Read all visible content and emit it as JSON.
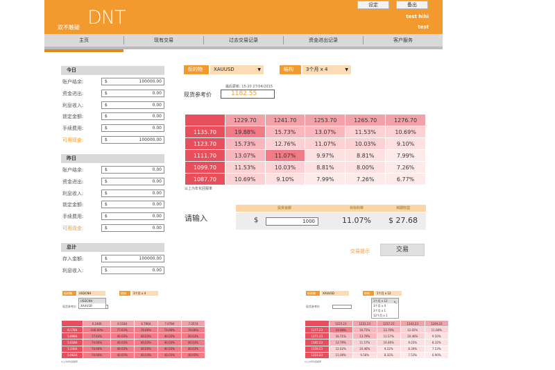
{
  "header": {
    "logo": "DNT",
    "tagline": "双不触碰",
    "btn_settings": "设定",
    "btn_logout": "备出",
    "user_line1": "test hihi",
    "user_line2": "test"
  },
  "nav": [
    "主页",
    "现有交易",
    "过去交易记录",
    "资金进出记录",
    "客户服务"
  ],
  "today": {
    "title": "今日",
    "rows": [
      {
        "label": "账户结余:",
        "currency": "$",
        "value": "100000.00",
        "highlight": false
      },
      {
        "label": "资金进出:",
        "currency": "$",
        "value": "0.00",
        "highlight": false
      },
      {
        "label": "利息收入:",
        "currency": "$",
        "value": "0.00",
        "highlight": false
      },
      {
        "label": "锁定金额:",
        "currency": "$",
        "value": "0.00",
        "highlight": false
      },
      {
        "label": "手续费用:",
        "currency": "$",
        "value": "0.00",
        "highlight": false
      },
      {
        "label": "可用现金:",
        "currency": "$",
        "value": "100000.00",
        "highlight": true
      }
    ]
  },
  "yesterday": {
    "title": "昨日",
    "rows": [
      {
        "label": "账户结余:",
        "currency": "$",
        "value": "0.00",
        "highlight": false
      },
      {
        "label": "资金进出:",
        "currency": "$",
        "value": "0.00",
        "highlight": false
      },
      {
        "label": "利息收入:",
        "currency": "$",
        "value": "0.00",
        "highlight": false
      },
      {
        "label": "锁定金额:",
        "currency": "$",
        "value": "0.00",
        "highlight": false
      },
      {
        "label": "手续费用:",
        "currency": "$",
        "value": "0.00",
        "highlight": false
      },
      {
        "label": "可用现金:",
        "currency": "$",
        "value": "0.00",
        "highlight": true
      }
    ]
  },
  "total": {
    "title": "总计",
    "rows": [
      {
        "label": "存入金额:",
        "currency": "$",
        "value": "100000.00",
        "highlight": false
      },
      {
        "label": "利息收入:",
        "currency": "$",
        "value": "0.00",
        "highlight": false
      }
    ]
  },
  "controls": {
    "underlying_label": "标的物",
    "underlying_value": "XAUUSD",
    "structure_label": "结构",
    "structure_value": "3个月 x 4",
    "updated": "最后更新: 15:20 27/04/2015",
    "ref_price_label": "现货参考价",
    "ref_price": "1182.55"
  },
  "matrix": {
    "cols": [
      "1229.70",
      "1241.70",
      "1253.70",
      "1265.70",
      "1276.70"
    ],
    "rows": [
      {
        "h": "1135.70",
        "v": [
          "19.88%",
          "15.73%",
          "13.07%",
          "11.53%",
          "10.69%"
        ]
      },
      {
        "h": "1123.70",
        "v": [
          "15.73%",
          "12.76%",
          "11.07%",
          "10.03%",
          "9.10%"
        ]
      },
      {
        "h": "1111.70",
        "v": [
          "13.07%",
          "11.07%",
          "9.97%",
          "8.81%",
          "7.99%"
        ]
      },
      {
        "h": "1099.70",
        "v": [
          "11.53%",
          "10.03%",
          "8.81%",
          "8.00%",
          "7.26%"
        ]
      },
      {
        "h": "1087.70",
        "v": [
          "10.69%",
          "9.10%",
          "7.99%",
          "7.26%",
          "6.77%"
        ]
      }
    ],
    "note": "以上为年化回报率"
  },
  "input_section": {
    "prompt": "请输入",
    "h_amount": "投资金额",
    "h_rate": "目标利率",
    "h_return": "到期收益",
    "currency": "$",
    "amount": "1000",
    "rate": "11.07%",
    "return": "$ 27.68",
    "hint": "交易提示",
    "trade_btn": "交易"
  },
  "thumb_left": {
    "underlying_label": "标的物",
    "underlying_value": "USDCNH",
    "structure_label": "结构",
    "structure_value": "3个月 x 4",
    "ref_label": "现货参考价",
    "dropdown": [
      "USDCNH",
      "XAUUSD"
    ],
    "cols": [
      "6.2406",
      "6.5184",
      "6.7964",
      "7.0784",
      "7.3574"
    ],
    "rows": [
      {
        "h": "6.1784",
        "v": [
          "100.00%",
          "77.63%",
          "74.66%",
          "74.66%",
          "74.66%"
        ]
      },
      {
        "h": "5.8964",
        "v": [
          "77.63%",
          "40.03%",
          "40.03%",
          "40.03%",
          "40.03%"
        ]
      },
      {
        "h": "5.6184",
        "v": [
          "74.66%",
          "40.03%",
          "40.03%",
          "40.03%",
          "40.03%"
        ]
      },
      {
        "h": "5.3404",
        "v": [
          "74.66%",
          "40.03%",
          "40.03%",
          "40.03%",
          "40.03%"
        ]
      },
      {
        "h": "5.0624",
        "v": [
          "74.66%",
          "40.03%",
          "40.03%",
          "40.03%",
          "40.03%"
        ]
      }
    ],
    "note": "以上为年化回报率"
  },
  "thumb_right": {
    "underlying_label": "标的物",
    "underlying_value": "XAUUSD",
    "structure_label": "结构",
    "structure_value": "1个月 x 12",
    "ref_label": "现货参考价",
    "dropdown": [
      "1个月 x 12",
      "3个月 x 4",
      "3个月 x 1",
      "12个月 x 1"
    ],
    "cols": [
      "1225.23",
      "1231.23",
      "1237.23",
      "1243.23",
      "1249.23"
    ],
    "rows": [
      {
        "h": "1177.23",
        "v": [
          "19.98%",
          "16.71%",
          "13.79%",
          "12.02%",
          "11.08%"
        ]
      },
      {
        "h": "1171.23",
        "v": [
          "16.71%",
          "13.79%",
          "11.57%",
          "10.46%",
          "9.50%"
        ]
      },
      {
        "h": "1165.23",
        "v": [
          "13.79%",
          "11.57%",
          "10.46%",
          "9.22%",
          "8.32%"
        ]
      },
      {
        "h": "1159.23",
        "v": [
          "12.02%",
          "10.46%",
          "9.22%",
          "8.34%",
          "7.53%"
        ]
      },
      {
        "h": "1153.23",
        "v": [
          "11.08%",
          "9.50%",
          "8.32%",
          "7.53%",
          "6.90%"
        ]
      }
    ],
    "note": "以上为年化回报率"
  }
}
